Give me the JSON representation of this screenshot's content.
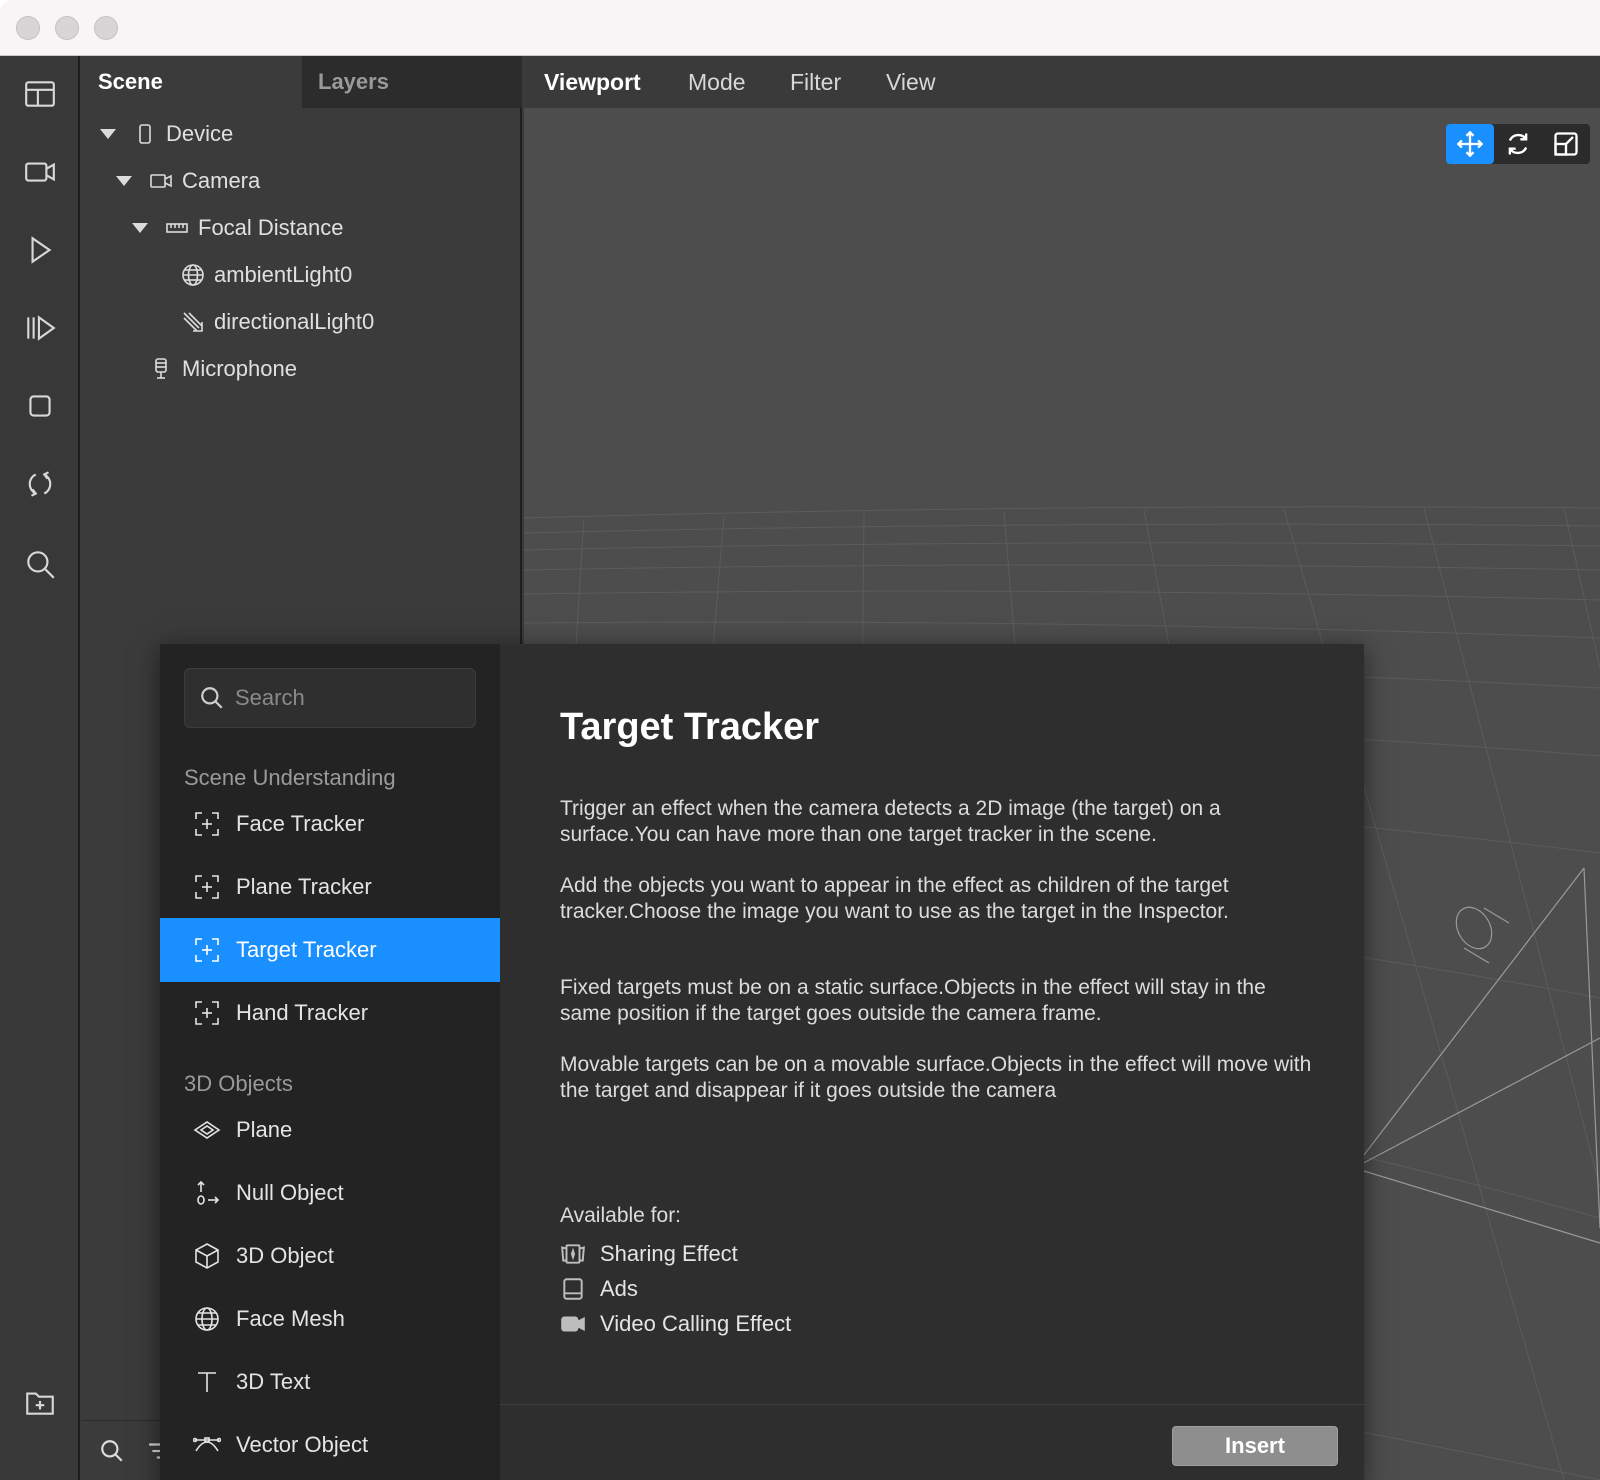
{
  "scene_panel": {
    "tabs": [
      {
        "label": "Scene"
      },
      {
        "label": "Layers"
      }
    ],
    "tree": [
      {
        "label": "Device",
        "icon": "phone-icon"
      },
      {
        "label": "Camera",
        "icon": "camera-icon"
      },
      {
        "label": "Focal Distance",
        "icon": "ruler-icon"
      },
      {
        "label": "ambientLight0",
        "icon": "globe-light-icon"
      },
      {
        "label": "directionalLight0",
        "icon": "directional-light-icon"
      },
      {
        "label": "Microphone",
        "icon": "microphone-icon"
      }
    ]
  },
  "viewport": {
    "menu": [
      {
        "label": "Viewport"
      },
      {
        "label": "Mode"
      },
      {
        "label": "Filter"
      },
      {
        "label": "View"
      }
    ],
    "tools": [
      "move-icon",
      "rotate-icon",
      "scale-icon"
    ]
  },
  "library": {
    "search_placeholder": "Search",
    "categories": [
      {
        "label": "Scene Understanding"
      },
      {
        "label": "3D Objects"
      }
    ],
    "items": [
      {
        "label": "Face Tracker",
        "icon": "tracker-icon"
      },
      {
        "label": "Plane Tracker",
        "icon": "tracker-icon"
      },
      {
        "label": "Target Tracker",
        "icon": "tracker-icon",
        "selected": true
      },
      {
        "label": "Hand Tracker",
        "icon": "tracker-icon"
      },
      {
        "label": "Plane",
        "icon": "plane-icon"
      },
      {
        "label": "Null Object",
        "icon": "null-object-icon"
      },
      {
        "label": "3D Object",
        "icon": "cube-icon"
      },
      {
        "label": "Face Mesh",
        "icon": "face-mesh-icon"
      },
      {
        "label": "3D Text",
        "icon": "text-icon"
      },
      {
        "label": "Vector Object",
        "icon": "vector-icon"
      }
    ]
  },
  "detail": {
    "title": "Target Tracker",
    "paragraphs": [
      "Trigger an effect when the camera detects a 2D image (the target) on a surface.You can have more than one target tracker in the scene.",
      "Add the objects you want to appear in the effect as children of the target tracker.Choose the image you want to use as the target in the Inspector.",
      "Fixed targets must be on a static surface.Objects in the effect will stay in the same position if the target goes outside the camera frame.",
      "Movable targets can be on a movable surface.Objects in the effect will move with the target and disappear if it goes outside the camera"
    ],
    "available_label": "Available for:",
    "available": [
      {
        "label": "Sharing Effect",
        "icon": "sharing-effect-icon"
      },
      {
        "label": "Ads",
        "icon": "ads-icon"
      },
      {
        "label": "Video Calling Effect",
        "icon": "video-call-icon"
      }
    ],
    "insert_label": "Insert"
  },
  "colors": {
    "accent": "#1a8fff",
    "panel": "#3b3b3b",
    "dialog": "#2e2e2e"
  }
}
